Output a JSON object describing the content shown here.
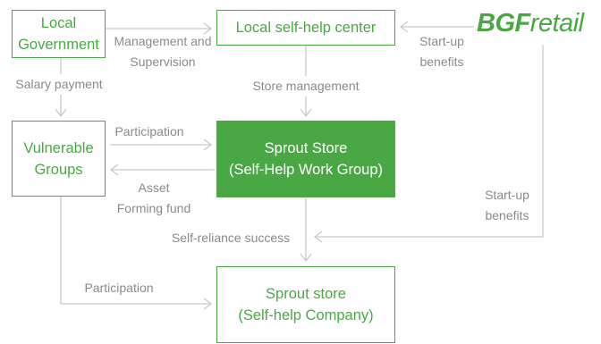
{
  "colors": {
    "accent": "#4aa844",
    "line": "#c9c9c9",
    "label": "#8a8a8a"
  },
  "logo": {
    "bold": "BGF",
    "rest": "retail"
  },
  "boxes": {
    "local_government": "Local\nGovernment",
    "self_help_center": "Local self-help center",
    "vulnerable_groups": "Vulnerable\nGroups",
    "sprout_store_work_group": "Sprout Store\n(Self-Help Work Group)",
    "sprout_store_company": "Sprout store\n(Self-help Company)"
  },
  "labels": {
    "management_supervision": "Management and\nSupervision",
    "startup_benefits_top": "Start-up\nbenefits",
    "salary_payment": "Salary payment",
    "store_management": "Store management",
    "participation_top": "Participation",
    "asset_forming_fund": "Asset\nForming fund",
    "startup_benefits_right": "Start-up\nbenefits",
    "self_reliance_success": "Self-reliance success",
    "participation_bottom": "Participation"
  }
}
